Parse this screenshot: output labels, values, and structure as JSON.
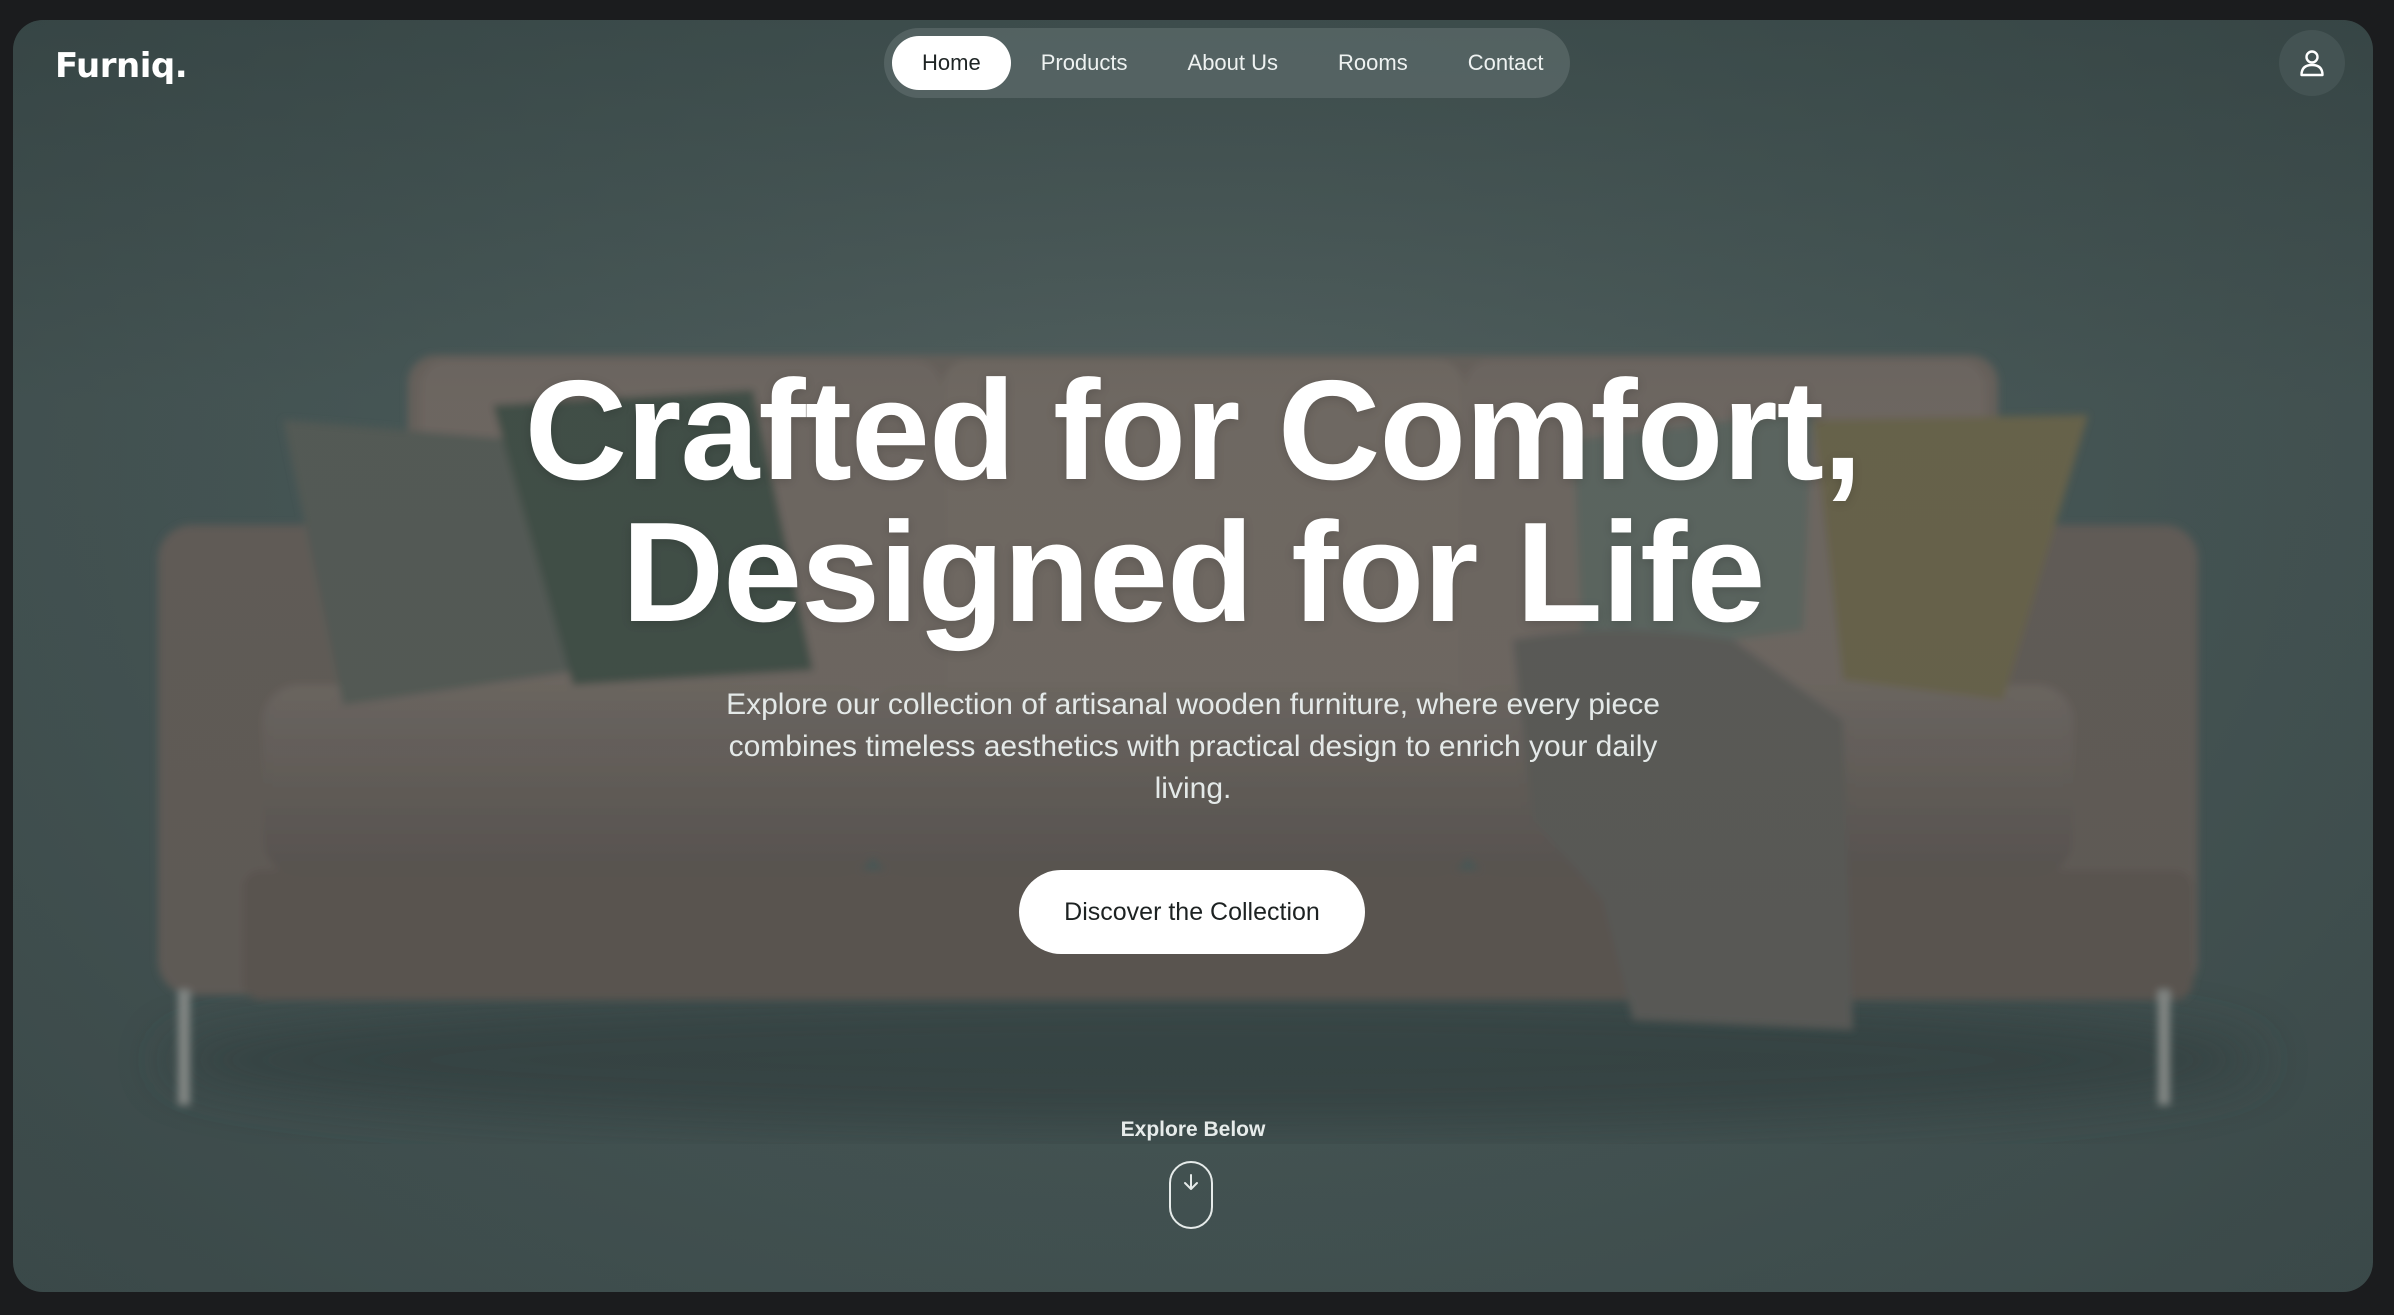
{
  "brand": {
    "logo": "Furniq."
  },
  "nav": {
    "items": [
      {
        "label": "Home",
        "active": true
      },
      {
        "label": "Products",
        "active": false
      },
      {
        "label": "About Us",
        "active": false
      },
      {
        "label": "Rooms",
        "active": false
      },
      {
        "label": "Contact",
        "active": false
      }
    ]
  },
  "header": {
    "user_icon": "user-icon"
  },
  "hero": {
    "title_line1": "Crafted for Comfort,",
    "title_line2": "Designed for Life",
    "subtitle_line1": "Explore our collection of artisanal wooden furniture, where every piece",
    "subtitle_line2": "combines timeless aesthetics with practical design to enrich your daily",
    "subtitle_line3": "living.",
    "cta_label": "Discover the Collection"
  },
  "scroll": {
    "label": "Explore Below",
    "icon": "arrow-down-icon"
  },
  "colors": {
    "background": "#465655",
    "nav_pill": "#5a6868",
    "active_pill": "#ffffff",
    "text": "#ffffff"
  }
}
